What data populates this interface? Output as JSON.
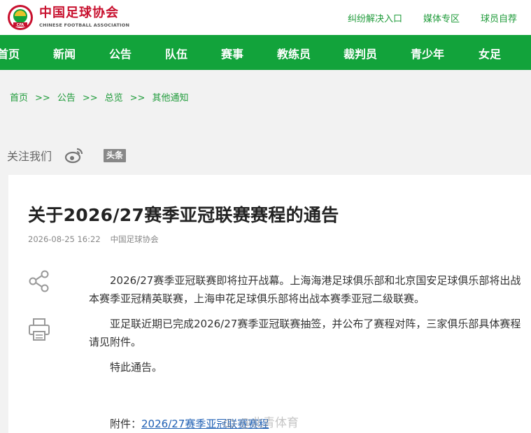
{
  "header": {
    "brand_cn": "中国足球协会",
    "brand_en": "CHINESE FOOTBALL ASSOCIATION",
    "logo_text": "CFA",
    "links": [
      "纠纷解决入口",
      "媒体专区",
      "球员自荐"
    ]
  },
  "nav": {
    "items": [
      "首页",
      "新闻",
      "公告",
      "队伍",
      "赛事",
      "教练员",
      "裁判员",
      "青少年",
      "女足"
    ]
  },
  "breadcrumb": {
    "items": [
      "首页",
      "公告",
      "总览",
      "其他通知"
    ],
    "separator": ">>"
  },
  "follow": {
    "label": "关注我们",
    "weibo_icon": "weibo-icon",
    "toutiao_label": "头条"
  },
  "article": {
    "title": "关于2026/27赛季亚冠联赛赛程的通告",
    "date": "2026-08-25 16:22",
    "source": "中国足球协会",
    "paragraphs": [
      "2026/27赛季亚冠联赛即将拉开战幕。上海海港足球俱乐部和北京国安足球俱乐部将出战本赛季亚冠精英联赛，上海申花足球俱乐部将出战本赛季亚冠二级联赛。",
      "亚足联近期已完成2026/27赛季亚冠联赛抽签，并公布了赛程对阵，三家俱乐部具体赛程请见附件。",
      "特此通告。"
    ],
    "attachment_label": "附件：",
    "attachment_link": "2026/27赛季亚冠联赛赛程"
  },
  "watermark": "@北青体育",
  "colors": {
    "brand_green": "#12a33b",
    "link_green": "#1f9b3a",
    "brand_red": "#c8102e",
    "link_blue": "#1e5fb4"
  }
}
